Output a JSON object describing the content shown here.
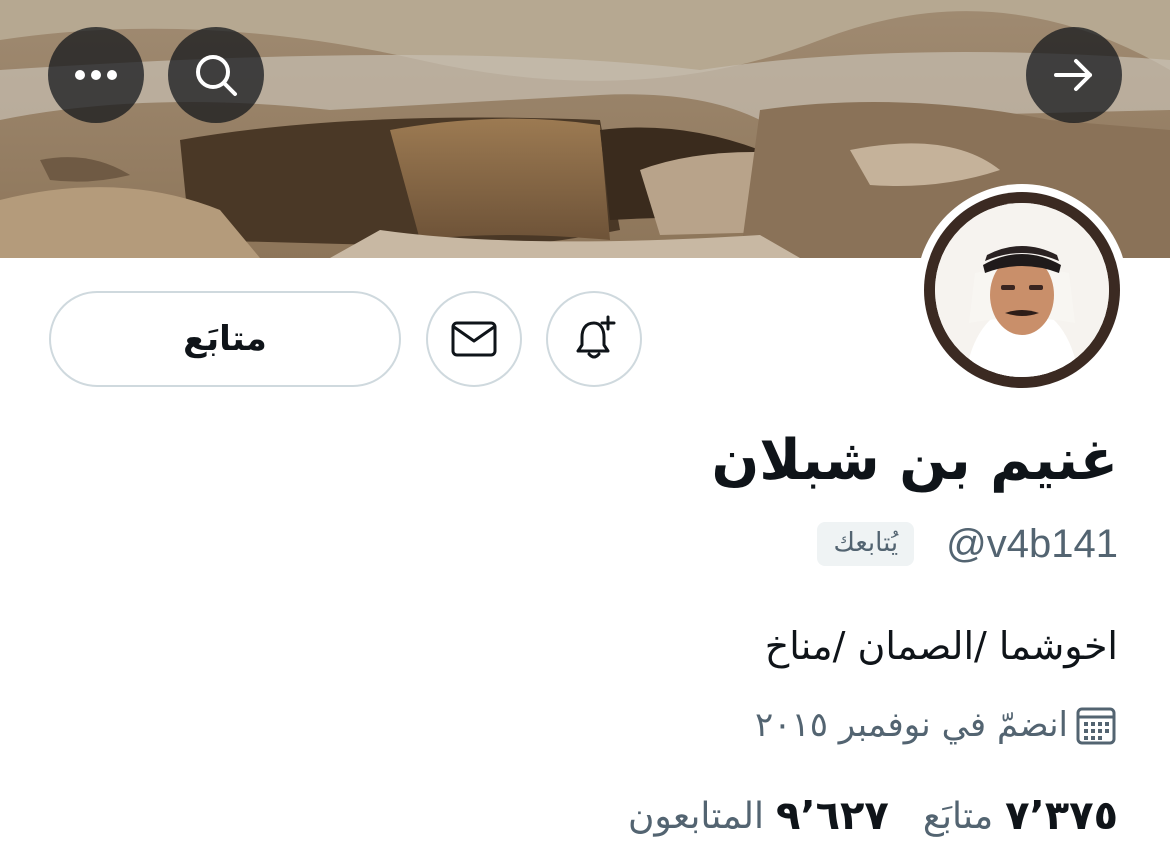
{
  "header": {
    "back_icon": "arrow-right-icon",
    "search_icon": "search-icon",
    "more_icon": "more-horizontal-icon"
  },
  "profile": {
    "name": "غنيم بن شبلان",
    "handle": "@v4b141",
    "follows_you_label": "يُتابعك",
    "bio": "اخوشما /الصمان /مناخ",
    "joined_text": "انضمّ في نوفمبر ٢٠١٥"
  },
  "actions": {
    "follow_label": "متابَع",
    "notify_icon": "bell-plus-icon",
    "message_icon": "mail-icon"
  },
  "stats": {
    "following_count": "٧٬٣٧٥",
    "following_label": "متابَع",
    "followers_count": "٩٬٦٢٧",
    "followers_label": "المتابعون"
  },
  "colors": {
    "text_primary": "#0f1419",
    "text_secondary": "#536471",
    "border": "#cfd9de",
    "badge_bg": "#eff3f4"
  }
}
